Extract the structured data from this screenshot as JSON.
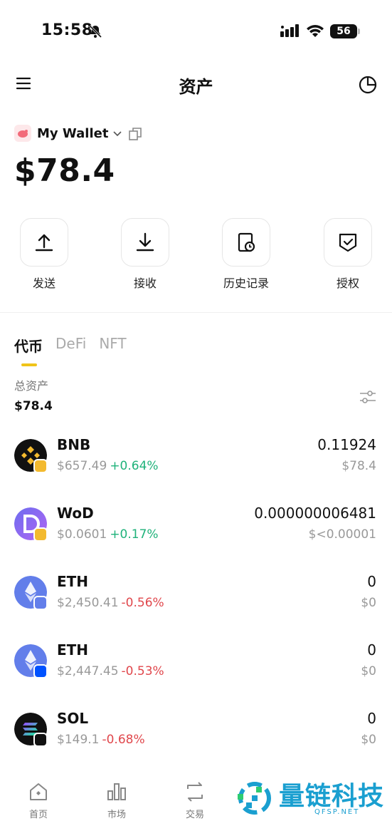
{
  "status_bar": {
    "time": "15:58",
    "battery": "56"
  },
  "header": {
    "title": "资产",
    "menu_icon": "hamburger-menu-icon",
    "right_icon": "pie-chart-icon"
  },
  "wallet": {
    "name": "My Wallet",
    "balance": "$78.4"
  },
  "actions": [
    {
      "label": "发送",
      "icon": "upload-icon"
    },
    {
      "label": "接收",
      "icon": "download-icon"
    },
    {
      "label": "历史记录",
      "icon": "history-icon"
    },
    {
      "label": "授权",
      "icon": "shield-check-icon"
    }
  ],
  "tabs": [
    {
      "label": "代币",
      "active": true
    },
    {
      "label": "DeFi",
      "active": false
    },
    {
      "label": "NFT",
      "active": false
    }
  ],
  "total": {
    "label": "总资产",
    "value": "$78.4"
  },
  "tokens": [
    {
      "symbol": "BNB",
      "price": "$657.49",
      "change": "+0.64%",
      "direction": "up",
      "amount": "0.11924",
      "fiat": "$78.4",
      "color": "#f3ba2f",
      "badge_color": "#f3ba2f"
    },
    {
      "symbol": "WoD",
      "price": "$0.0601",
      "change": "+0.17%",
      "direction": "up",
      "amount": "0.000000006481",
      "fiat": "$<0.00001",
      "color": "#6c5ce7",
      "badge_color": "#f3ba2f"
    },
    {
      "symbol": "ETH",
      "price": "$2,450.41",
      "change": "-0.56%",
      "direction": "down",
      "amount": "0",
      "fiat": "$0",
      "color": "#627eea",
      "badge_color": "#627eea"
    },
    {
      "symbol": "ETH",
      "price": "$2,447.45",
      "change": "-0.53%",
      "direction": "down",
      "amount": "0",
      "fiat": "$0",
      "color": "#627eea",
      "badge_color": "#0052ff"
    },
    {
      "symbol": "SOL",
      "price": "$149.1",
      "change": "-0.68%",
      "direction": "down",
      "amount": "0",
      "fiat": "$0",
      "color": "#111111",
      "badge_color": "#111111"
    }
  ],
  "bottom_nav": [
    {
      "label": "首页",
      "icon": "home-icon"
    },
    {
      "label": "市场",
      "icon": "bar-chart-icon"
    },
    {
      "label": "交易",
      "icon": "swap-icon"
    }
  ],
  "watermark": {
    "brand": "量链科技",
    "site": "QFSP.NET"
  }
}
